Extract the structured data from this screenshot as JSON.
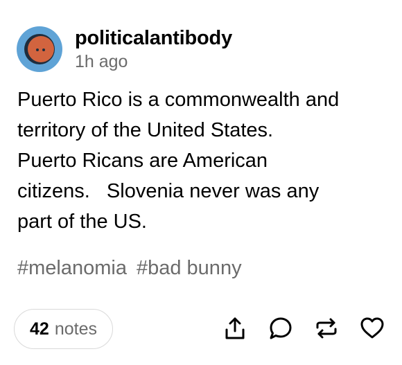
{
  "post": {
    "username": "politicalantibody",
    "timestamp": "1h ago",
    "body": "Puerto Rico is a commonwealth and\nterritory of the United States.\nPuerto Ricans are American\ncitizens.   Slovenia never was any\npart of the US.",
    "tags": [
      "#melanomia",
      "#bad bunny"
    ]
  },
  "footer": {
    "notes_count": "42",
    "notes_label": "notes"
  },
  "icons": {
    "share": "share-icon",
    "reply": "reply-icon",
    "reblog": "reblog-icon",
    "like": "heart-icon"
  },
  "colors": {
    "avatar_ring": "#5fa3d6",
    "avatar_face": "#d2643f",
    "muted_text": "#6b6b6b",
    "border": "#d9d9d9"
  }
}
